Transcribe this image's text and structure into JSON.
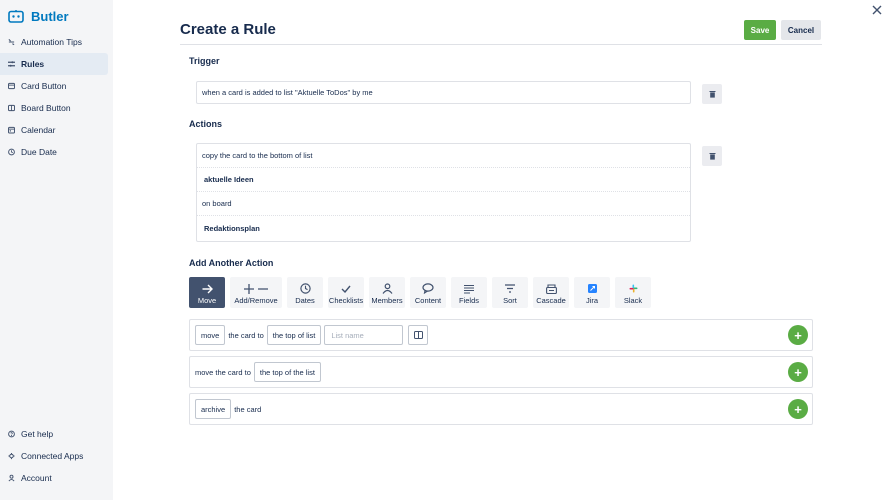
{
  "sidebar": {
    "brand": "Butler",
    "items": [
      {
        "label": "Automation Tips",
        "icon": "bulb-icon"
      },
      {
        "label": "Rules",
        "icon": "rules-icon",
        "active": true
      },
      {
        "label": "Card Button",
        "icon": "card-icon"
      },
      {
        "label": "Board Button",
        "icon": "board-icon"
      },
      {
        "label": "Calendar",
        "icon": "calendar-icon"
      },
      {
        "label": "Due Date",
        "icon": "clock-icon"
      }
    ],
    "bottom_items": [
      {
        "label": "Get help",
        "icon": "help-icon"
      },
      {
        "label": "Connected Apps",
        "icon": "apps-icon"
      },
      {
        "label": "Account",
        "icon": "user-icon"
      }
    ]
  },
  "header": {
    "title": "Create a Rule",
    "save_label": "Save",
    "cancel_label": "Cancel"
  },
  "trigger": {
    "heading": "Trigger",
    "text": "when a card is added to list \"Aktuelle ToDos\" by me"
  },
  "actions": {
    "heading": "Actions",
    "rows": [
      {
        "text": "copy the card to the bottom of list"
      },
      {
        "text": "aktuelle Ideen"
      },
      {
        "text": "on board"
      },
      {
        "text": "Redaktionsplan"
      }
    ]
  },
  "add_action": {
    "heading": "Add Another Action",
    "tabs": [
      {
        "label": "Move",
        "icon": "arrow-right-icon"
      },
      {
        "label": "Add/Remove",
        "icon": "plus-minus-icon"
      },
      {
        "label": "Dates",
        "icon": "clock-icon"
      },
      {
        "label": "Checklists",
        "icon": "check-icon"
      },
      {
        "label": "Members",
        "icon": "member-icon"
      },
      {
        "label": "Content",
        "icon": "comment-icon"
      },
      {
        "label": "Fields",
        "icon": "fields-icon"
      },
      {
        "label": "Sort",
        "icon": "sort-icon"
      },
      {
        "label": "Cascade",
        "icon": "cascade-icon"
      },
      {
        "label": "Jira",
        "icon": "jira-icon"
      },
      {
        "label": "Slack",
        "icon": "slack-icon"
      }
    ]
  },
  "options": {
    "o1": {
      "verb": "move",
      "text1": "the card to",
      "position": "the top of list",
      "placeholder": "List name"
    },
    "o2": {
      "text1": "move the card to",
      "position": "the top of the list"
    },
    "o3": {
      "verb": "archive",
      "text1": "the card"
    }
  },
  "colors": {
    "accent": "#5aac44",
    "brand": "#0079bf",
    "active_tab": "#42526e"
  }
}
